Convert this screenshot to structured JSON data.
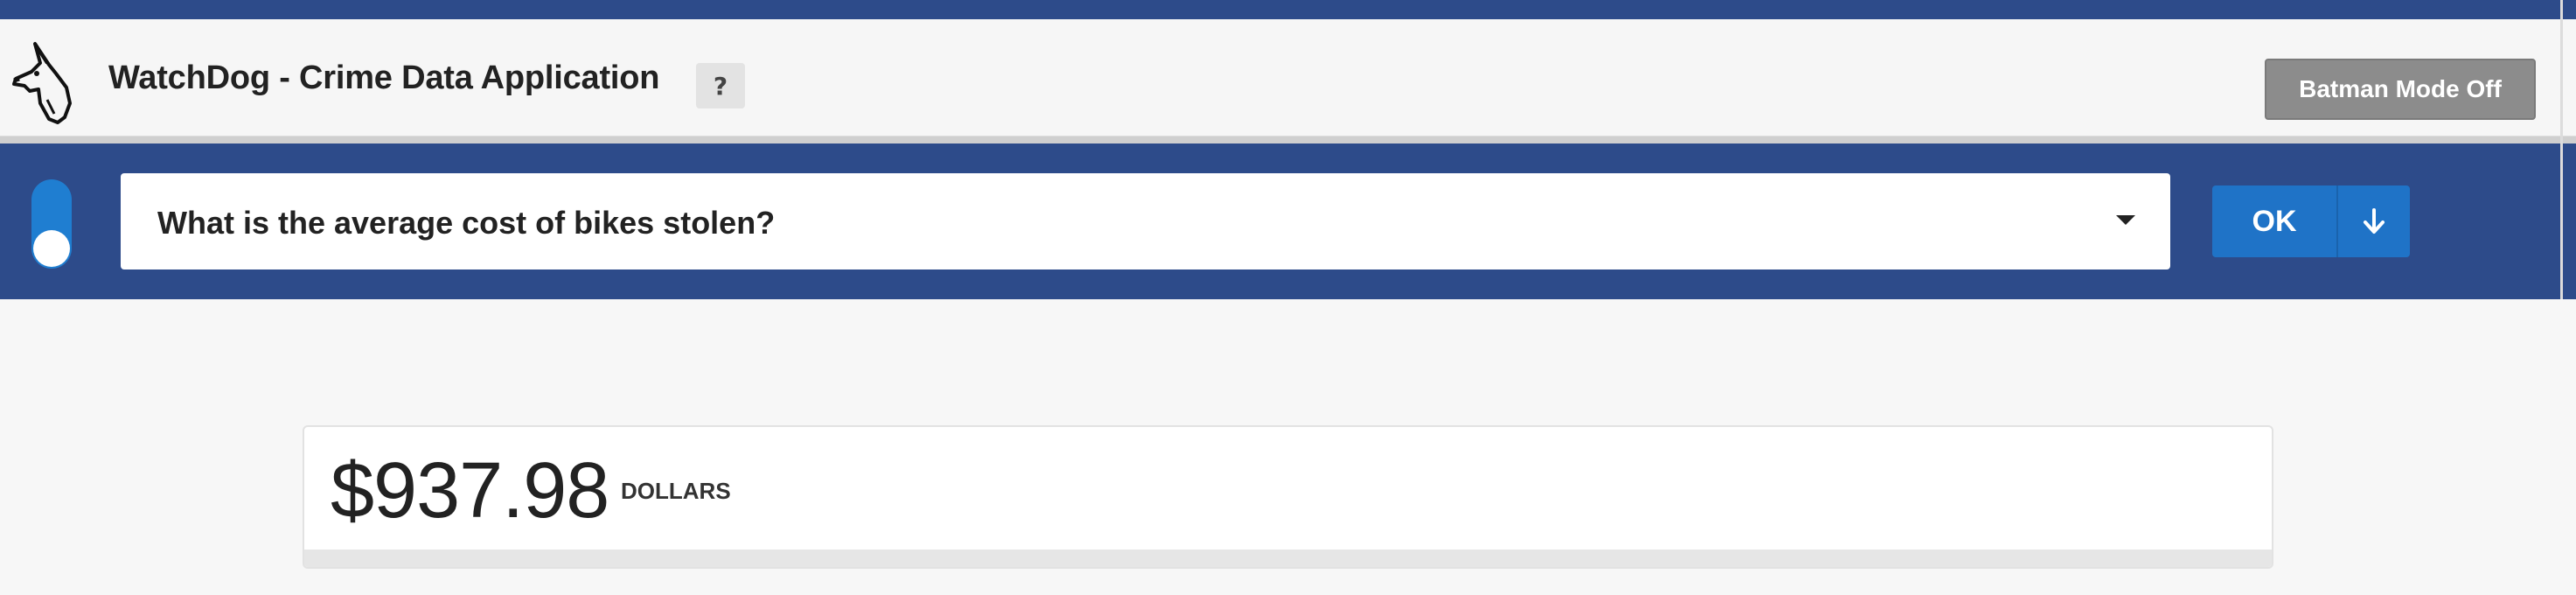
{
  "app": {
    "title": "WatchDog - Crime Data Application",
    "help_label": "?",
    "logo_icon": "dog-head-icon"
  },
  "header": {
    "batman_mode_label": "Batman Mode Off"
  },
  "query": {
    "toggle_on": true,
    "selected_question": "What is the average cost of bikes stolen?",
    "ok_label": "OK",
    "download_icon": "arrow-down-icon"
  },
  "result": {
    "value": "$937.98",
    "unit": "DOLLARS"
  },
  "colors": {
    "brand_blue": "#2d4b8a",
    "accent_blue": "#1f73c7",
    "toggle_blue": "#1f7ed1",
    "batman_button_gray": "#8c8c8c",
    "page_background": "#f7f7f7"
  }
}
